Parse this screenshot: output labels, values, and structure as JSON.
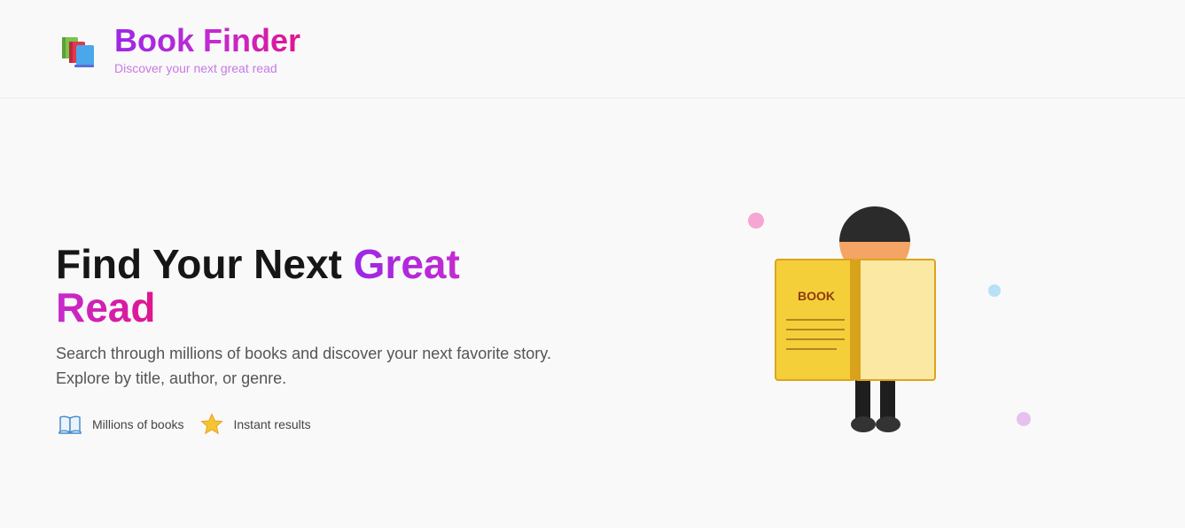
{
  "header": {
    "title": "Book Finder",
    "subtitle": "Discover your next great read",
    "logo_icon": "books-stack-icon"
  },
  "hero": {
    "title_plain": "Find Your Next ",
    "title_accent": "Great Read",
    "description": "Search through millions of books and discover your next favorite story. Explore by title, author, or genre.",
    "features": [
      {
        "icon": "open-book-icon",
        "label": "Millions of books"
      },
      {
        "icon": "star-icon",
        "label": "Instant results"
      }
    ]
  },
  "illustration": {
    "book_label": "BOOK"
  },
  "colors": {
    "brand_purple": "#9b27e6",
    "brand_pink": "#e0158e",
    "subtitle": "#c879e3",
    "book_yellow": "#f5cf3a",
    "book_page": "#fbe8a2",
    "skin": "#f4a464",
    "hair": "#2b2b2b"
  }
}
